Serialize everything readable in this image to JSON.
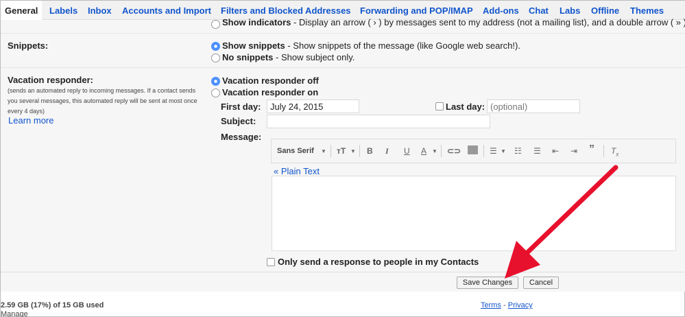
{
  "tabs": [
    {
      "label": "General"
    },
    {
      "label": "Labels"
    },
    {
      "label": "Inbox"
    },
    {
      "label": "Accounts and Import"
    },
    {
      "label": "Filters and Blocked Addresses"
    },
    {
      "label": "Forwarding and POP/IMAP"
    },
    {
      "label": "Add-ons"
    },
    {
      "label": "Chat"
    },
    {
      "label": "Labs"
    },
    {
      "label": "Offline"
    },
    {
      "label": "Themes"
    }
  ],
  "indicators": {
    "bold": "Show indicators",
    "text": " - Display an arrow ( › ) by messages sent to my address (not a mailing list), and a double arrow ( » ) b"
  },
  "snippets": {
    "label": "Snippets:",
    "show_bold": "Show snippets",
    "show_text": " - Show snippets of the message (like Google web search!).",
    "no_bold": "No snippets",
    "no_text": " - Show subject only."
  },
  "vacation": {
    "label": "Vacation responder:",
    "desc": "(sends an automated reply to incoming messages. If a contact sends you several messages, this automated reply will be sent at most once every 4 days)",
    "learn_more": "Learn more",
    "off": "Vacation responder off",
    "on": "Vacation responder on",
    "first_day_label": "First day:",
    "first_day_value": "July 24, 2015",
    "last_day_label": "Last day:",
    "last_day_placeholder": "(optional)",
    "subject_label": "Subject:",
    "subject_value": "",
    "message_label": "Message:",
    "plain_text": "« Plain Text",
    "contacts_only": "Only send a response to people in my Contacts"
  },
  "toolbar": {
    "font": "Sans Serif"
  },
  "actions": {
    "save": "Save Changes",
    "cancel": "Cancel"
  },
  "footer": {
    "storage": "2.59 GB (17%) of 15 GB used",
    "manage": "Manage",
    "terms": "Terms",
    "separator": " - ",
    "privacy": "Privacy"
  },
  "colors": {
    "link": "#1155cc",
    "arrow": "#e8112d",
    "radio_on": "#4d90fe"
  }
}
